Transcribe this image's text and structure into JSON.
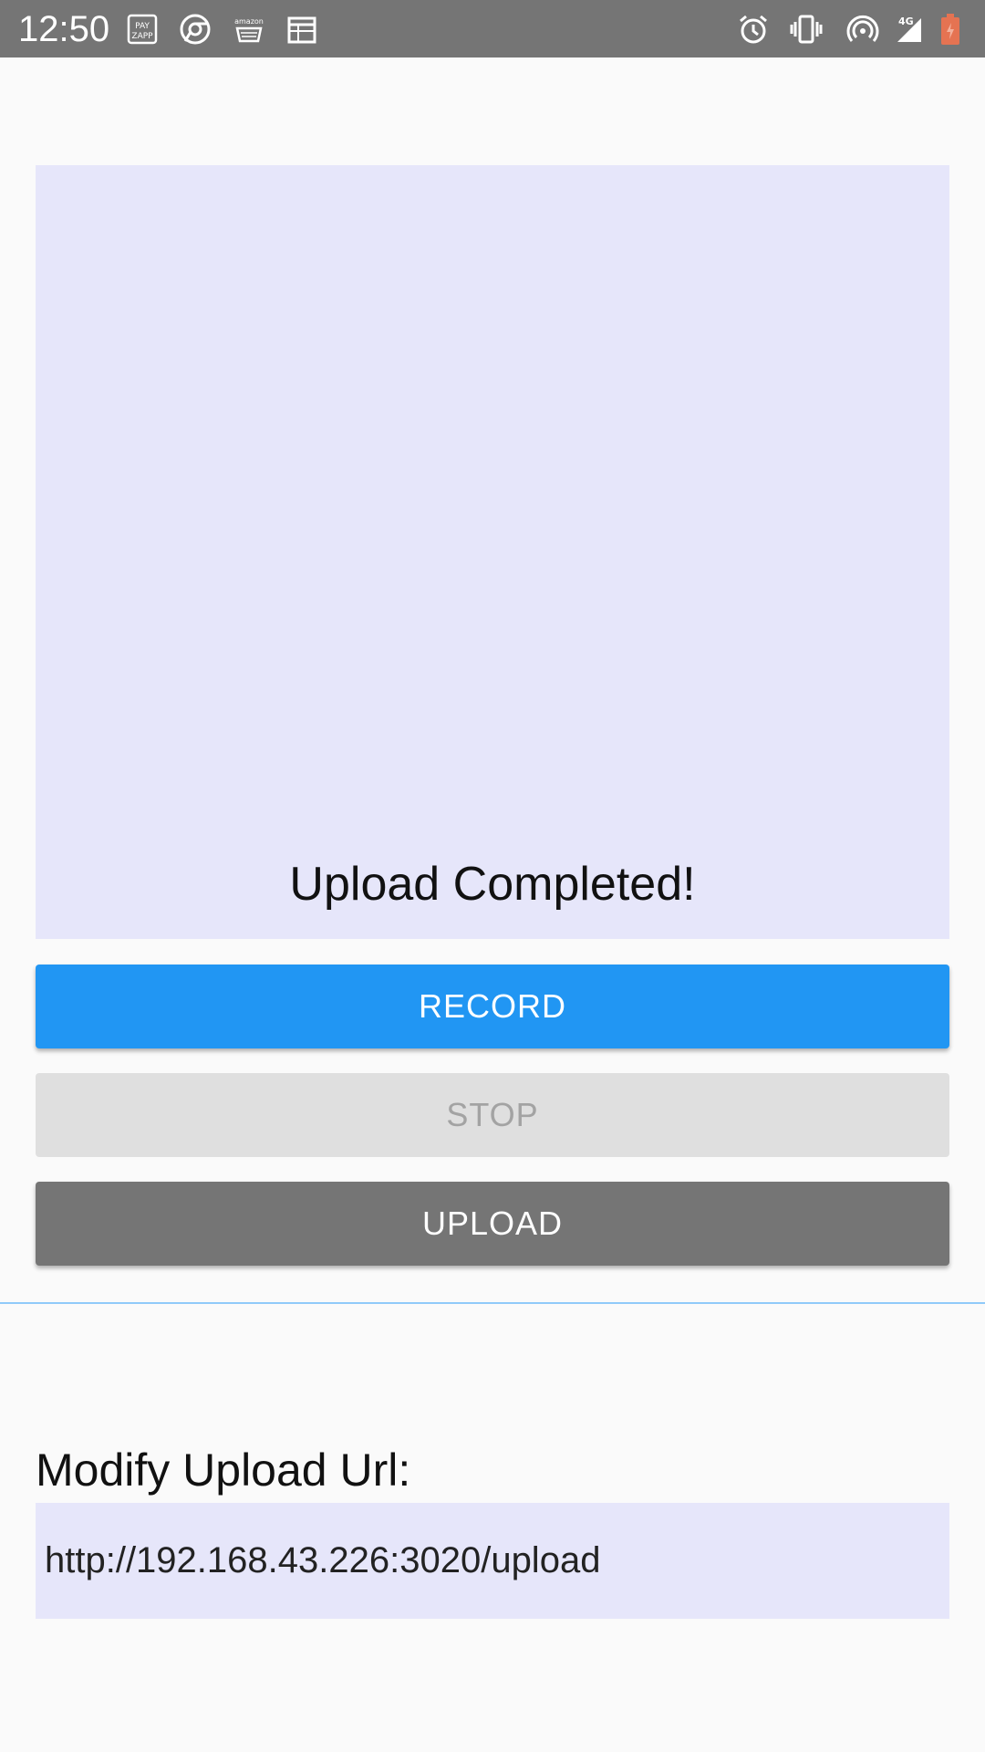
{
  "status_bar": {
    "time": "12:50",
    "left_icons": [
      "payzapp-icon",
      "chrome-icon",
      "amazon-icon",
      "calendar-icon"
    ],
    "right_icons": [
      "alarm-icon",
      "vibrate-icon",
      "hotspot-icon",
      "signal-4g-icon",
      "battery-icon"
    ],
    "network_label": "4G",
    "bar_color": "#757575",
    "battery_color": "#e57352"
  },
  "main": {
    "status_message": "Upload Completed!",
    "preview_bg": "#e6e6fa"
  },
  "buttons": {
    "record_label": "RECORD",
    "stop_label": "STOP",
    "upload_label": "UPLOAD",
    "record_color": "#2196f3",
    "stop_color": "#dfdfdf",
    "upload_color": "#757575"
  },
  "url_section": {
    "label": "Modify Upload Url:",
    "value": "http://192.168.43.226:3020/upload"
  }
}
